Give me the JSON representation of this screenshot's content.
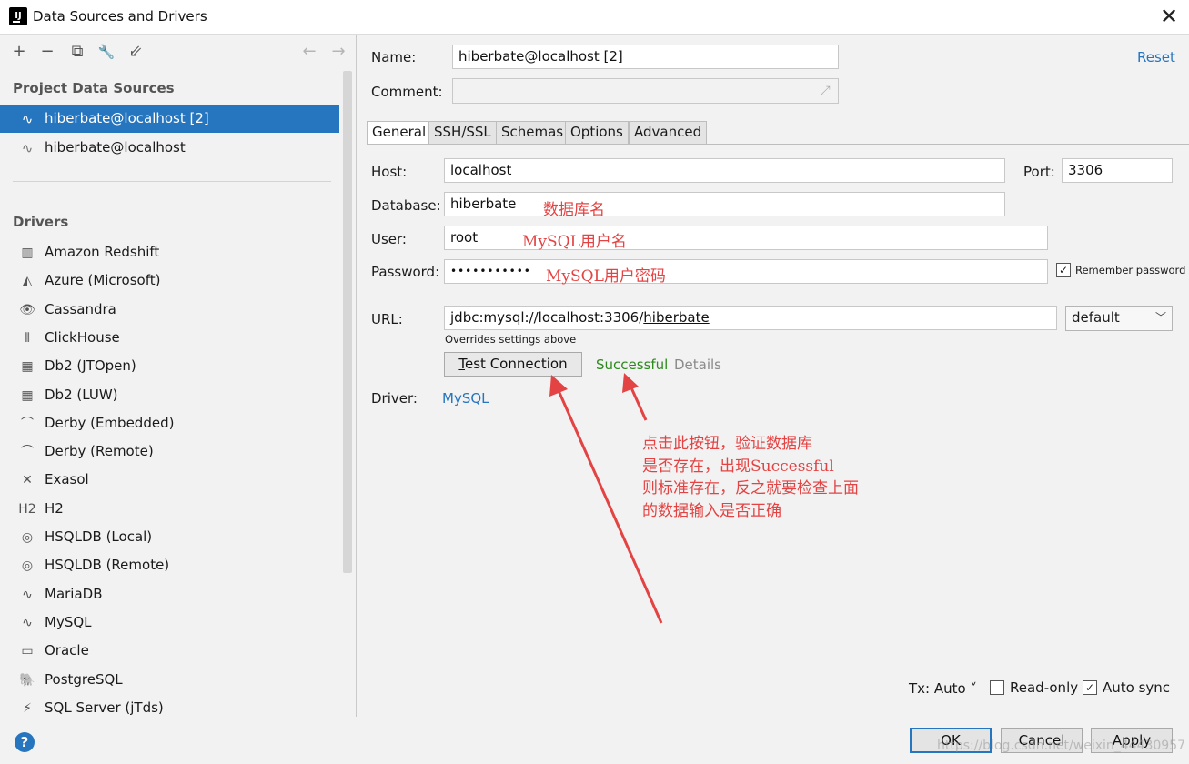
{
  "window": {
    "title": "Data Sources and Drivers",
    "app_icon": "IJ",
    "close": "✕"
  },
  "toolbar": {
    "add": "+",
    "remove": "−",
    "copy": "⧉",
    "wrench": "🔧",
    "import": "⇙",
    "back": "←",
    "forward": "→"
  },
  "left": {
    "project_header": "Project Data Sources",
    "data_sources": [
      {
        "label": "hiberbate@localhost [2]",
        "icon": "mysql-icon",
        "selected": true
      },
      {
        "label": "hiberbate@localhost",
        "icon": "mysql-icon",
        "selected": false
      }
    ],
    "drivers_header": "Drivers",
    "drivers": [
      {
        "label": "Amazon Redshift",
        "icon": "▥"
      },
      {
        "label": "Azure (Microsoft)",
        "icon": "◭"
      },
      {
        "label": "Cassandra",
        "icon": "👁"
      },
      {
        "label": "ClickHouse",
        "icon": "⦀"
      },
      {
        "label": "Db2 (JTOpen)",
        "icon": "▦"
      },
      {
        "label": "Db2 (LUW)",
        "icon": "▦"
      },
      {
        "label": "Derby (Embedded)",
        "icon": "⌒"
      },
      {
        "label": "Derby (Remote)",
        "icon": "⌒"
      },
      {
        "label": "Exasol",
        "icon": "✕"
      },
      {
        "label": "H2",
        "icon": "H2"
      },
      {
        "label": "HSQLDB (Local)",
        "icon": "◎"
      },
      {
        "label": "HSQLDB (Remote)",
        "icon": "◎"
      },
      {
        "label": "MariaDB",
        "icon": "∿"
      },
      {
        "label": "MySQL",
        "icon": "∿"
      },
      {
        "label": "Oracle",
        "icon": "▭"
      },
      {
        "label": "PostgreSQL",
        "icon": "🐘"
      },
      {
        "label": "SQL Server (jTds)",
        "icon": "⚡"
      }
    ]
  },
  "form": {
    "name_label": "Name:",
    "name_value": "hiberbate@localhost [2]",
    "comment_label": "Comment:",
    "comment_value": "",
    "reset": "Reset",
    "tabs": [
      "General",
      "SSH/SSL",
      "Schemas",
      "Options",
      "Advanced"
    ],
    "host_label": "Host:",
    "host_value": "localhost",
    "port_label": "Port:",
    "port_value": "3306",
    "database_label": "Database:",
    "database_value": "hiberbate",
    "user_label": "User:",
    "user_value": "root",
    "password_label": "Password:",
    "password_value": "•••••••••••",
    "remember_label": "Remember password",
    "remember_checked": "✓",
    "url_label": "URL:",
    "url_prefix": "jdbc:mysql://localhost:3306/",
    "url_db": "hiberbate",
    "url_mode": "default",
    "overrides": "Overrides settings above",
    "test_btn_underlined": "T",
    "test_btn_rest": "est Connection",
    "status": "Successful",
    "details": "Details",
    "driver_label": "Driver:",
    "driver_value": "MySQL"
  },
  "annotations": {
    "database_note": "数据库名",
    "user_note": "MySQL用户名",
    "password_note": "MySQL用户密码",
    "lines": [
      "点击此按钮，验证数据库",
      "是否存在，出现Successful",
      "则标准存在，反之就要检查上面",
      "的数据输入是否正确"
    ],
    "color": "#e34343"
  },
  "bottom": {
    "help": "?",
    "tx": "Tx: Auto ˅",
    "readonly": "Read-only",
    "autosync": "Auto sync",
    "autosync_checked": "✓",
    "ok": "OK",
    "cancel": "Cancel",
    "apply": "Apply",
    "watermark": "https://blog.csdn.net/weixin_44430957"
  }
}
